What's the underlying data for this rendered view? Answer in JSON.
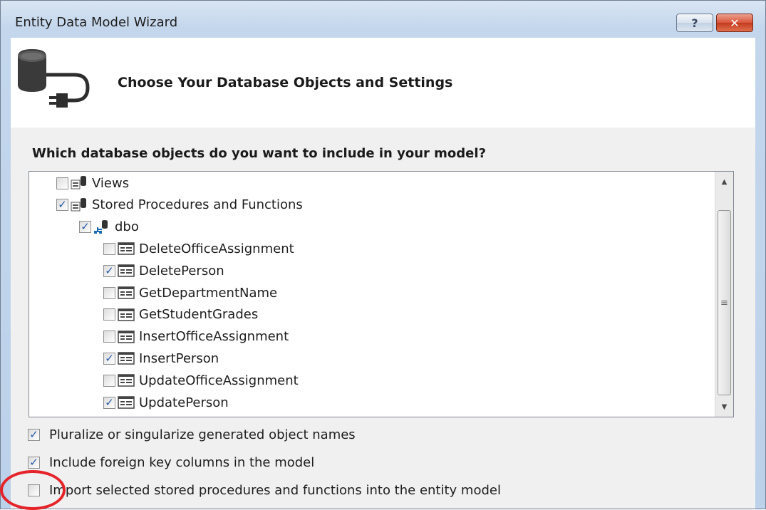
{
  "window": {
    "title": "Entity Data Model Wizard",
    "help_label": "?",
    "close_label": "✕"
  },
  "header": {
    "title": "Choose Your Database Objects and Settings",
    "icon": "database-connect-icon"
  },
  "question": "Which database objects do you want to include in your model?",
  "tree": {
    "items": [
      {
        "label": "Views",
        "checked": false,
        "icon": "views-icon",
        "level": 1
      },
      {
        "label": "Stored Procedures and Functions",
        "checked": true,
        "icon": "stored-procedures-icon",
        "level": 1
      },
      {
        "label": "dbo",
        "checked": true,
        "icon": "schema-icon",
        "level": 2
      },
      {
        "label": "DeleteOfficeAssignment",
        "checked": false,
        "icon": "procedure-icon",
        "level": 3
      },
      {
        "label": "DeletePerson",
        "checked": true,
        "icon": "procedure-icon",
        "level": 3
      },
      {
        "label": "GetDepartmentName",
        "checked": false,
        "icon": "procedure-icon",
        "level": 3
      },
      {
        "label": "GetStudentGrades",
        "checked": false,
        "icon": "procedure-icon",
        "level": 3
      },
      {
        "label": "InsertOfficeAssignment",
        "checked": false,
        "icon": "procedure-icon",
        "level": 3
      },
      {
        "label": "InsertPerson",
        "checked": true,
        "icon": "procedure-icon",
        "level": 3
      },
      {
        "label": "UpdateOfficeAssignment",
        "checked": false,
        "icon": "procedure-icon",
        "level": 3
      },
      {
        "label": "UpdatePerson",
        "checked": true,
        "icon": "procedure-icon",
        "level": 3
      }
    ]
  },
  "options": {
    "pluralize": {
      "label": "Pluralize or singularize generated object names",
      "checked": true
    },
    "foreign_keys": {
      "label": "Include foreign key columns in the model",
      "checked": true
    },
    "import_procs": {
      "label": "Import selected stored procedures and functions into the entity model",
      "checked": false
    }
  },
  "colors": {
    "check": "#2a5ba8",
    "highlight": "#e5242a",
    "close_button": "#d9553a"
  }
}
